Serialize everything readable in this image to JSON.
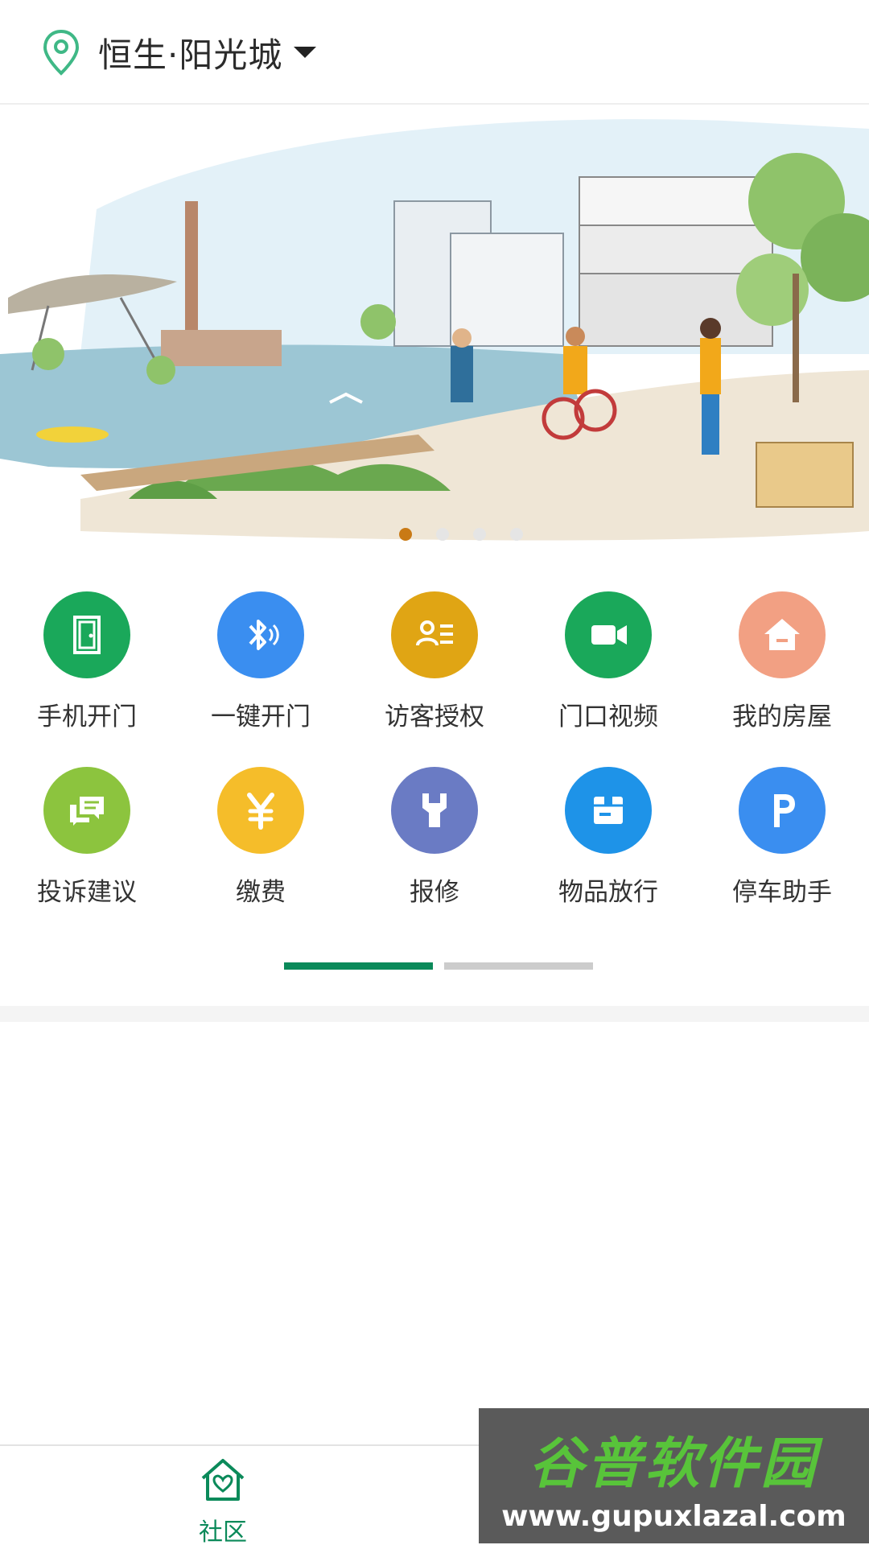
{
  "header": {
    "location": "恒生·阳光城"
  },
  "banner": {
    "slide_count": 4,
    "active_index": 0
  },
  "grid": {
    "rows": [
      [
        {
          "label": "手机开门",
          "color": "#1aa85a",
          "icon": "door-icon"
        },
        {
          "label": "一键开门",
          "color": "#3a8ef0",
          "icon": "bluetooth-icon"
        },
        {
          "label": "访客授权",
          "color": "#e0a514",
          "icon": "visitor-icon"
        },
        {
          "label": "门口视频",
          "color": "#1aa85a",
          "icon": "video-icon"
        },
        {
          "label": "我的房屋",
          "color": "#f2a083",
          "icon": "house-icon"
        }
      ],
      [
        {
          "label": "投诉建议",
          "color": "#8cc43e",
          "icon": "chat-icon"
        },
        {
          "label": "缴费",
          "color": "#f5bd2a",
          "icon": "yuan-icon"
        },
        {
          "label": "报修",
          "color": "#6a7bc4",
          "icon": "wrench-icon"
        },
        {
          "label": "物品放行",
          "color": "#1e93e8",
          "icon": "package-icon"
        },
        {
          "label": "停车助手",
          "color": "#3a8ef0",
          "icon": "parking-icon"
        }
      ]
    ],
    "pages": 2,
    "active_page": 0
  },
  "colors": {
    "accent": "#0b8a5a",
    "pin": "#3fb886"
  },
  "tabbar": {
    "tabs": [
      {
        "label": "社区",
        "icon": "home-heart-icon",
        "active": true
      }
    ]
  },
  "watermark": {
    "logo": "谷普软件园",
    "url": "www.gupuxlazal.com"
  }
}
